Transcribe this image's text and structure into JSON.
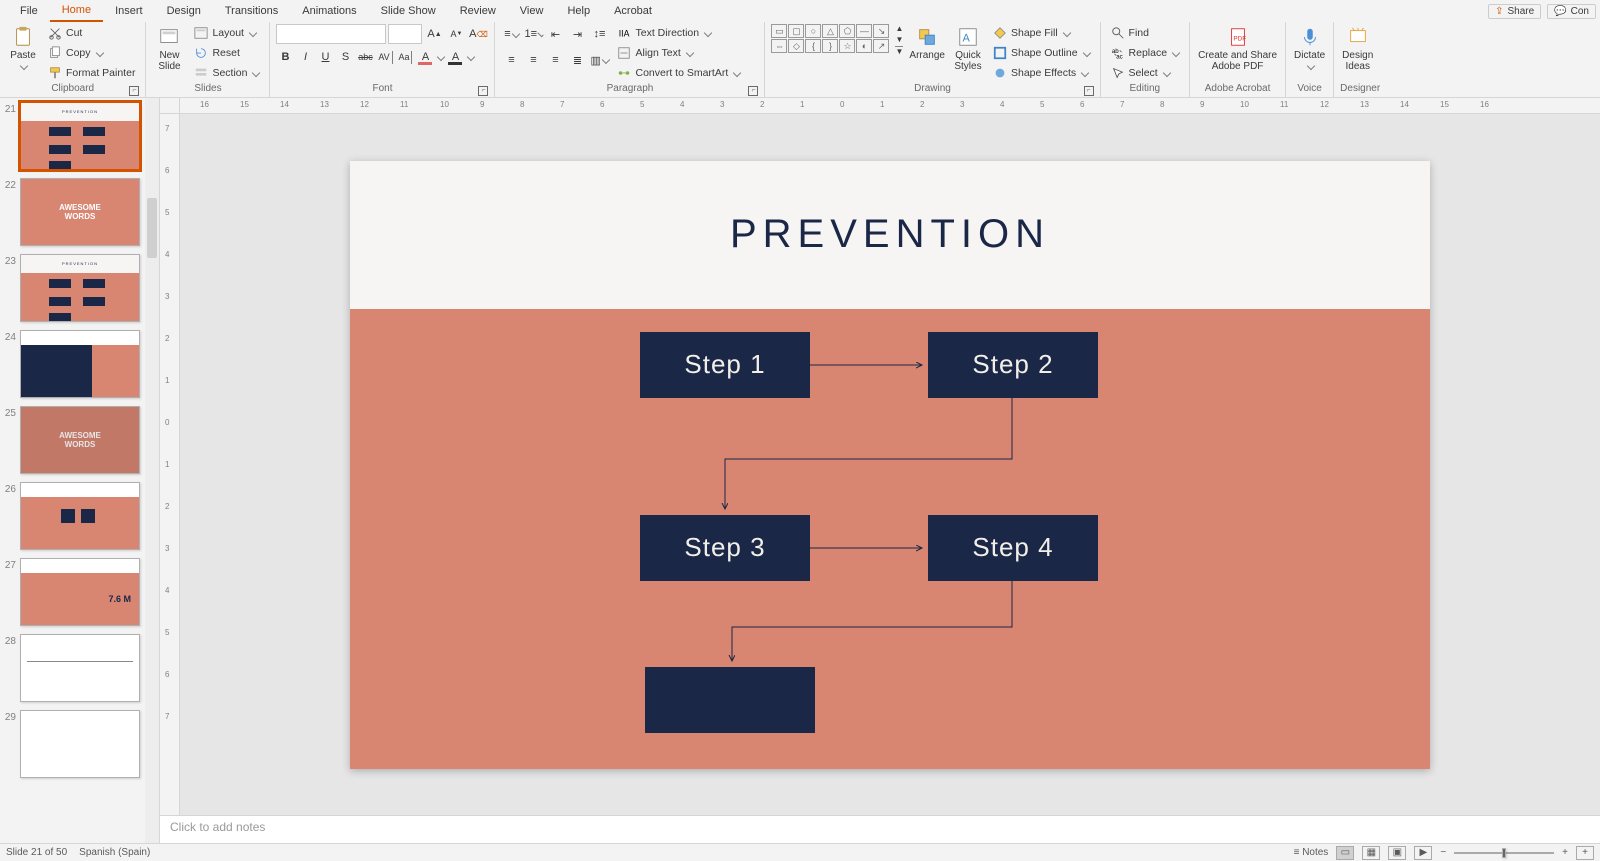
{
  "tabs": {
    "items": [
      "File",
      "Home",
      "Insert",
      "Design",
      "Transitions",
      "Animations",
      "Slide Show",
      "Review",
      "View",
      "Help",
      "Acrobat"
    ],
    "active": 1
  },
  "topright": {
    "share": "Share",
    "comments": "Con"
  },
  "ribbon": {
    "clipboard": {
      "label": "Clipboard",
      "paste": "Paste",
      "cut": "Cut",
      "copy": "Copy",
      "fp": "Format Painter"
    },
    "slides": {
      "label": "Slides",
      "new": "New\nSlide",
      "layout": "Layout",
      "reset": "Reset",
      "section": "Section"
    },
    "font": {
      "label": "Font",
      "family": "",
      "size": "",
      "bold": "B",
      "italic": "I",
      "underline": "U",
      "strike": "S",
      "shadow": "abc",
      "spacing": "AV",
      "case": "Aa",
      "clear": "A"
    },
    "paragraph": {
      "label": "Paragraph",
      "textdir": "Text Direction",
      "align": "Align Text",
      "smart": "Convert to SmartArt"
    },
    "drawing": {
      "label": "Drawing",
      "arrange": "Arrange",
      "quick": "Quick\nStyles",
      "fill": "Shape Fill",
      "outline": "Shape Outline",
      "effects": "Shape Effects"
    },
    "editing": {
      "label": "Editing",
      "find": "Find",
      "replace": "Replace",
      "select": "Select"
    },
    "adobe": {
      "label": "Adobe Acrobat",
      "btn": "Create and Share\nAdobe PDF"
    },
    "voice": {
      "label": "Voice",
      "btn": "Dictate"
    },
    "designer": {
      "label": "Designer",
      "btn": "Design\nIdeas"
    }
  },
  "hruler": [
    16,
    15,
    14,
    13,
    12,
    11,
    10,
    9,
    8,
    7,
    6,
    5,
    4,
    3,
    2,
    1,
    0,
    1,
    2,
    3,
    4,
    5,
    6,
    7,
    8,
    9,
    10,
    11,
    12,
    13,
    14,
    15,
    16
  ],
  "vruler": [
    7,
    6,
    5,
    4,
    3,
    2,
    1,
    0,
    1,
    2,
    3,
    4,
    5,
    6,
    7
  ],
  "thumbs": [
    {
      "n": 21,
      "kind": "prevention",
      "selected": true
    },
    {
      "n": 22,
      "kind": "awesome"
    },
    {
      "n": 23,
      "kind": "prevention"
    },
    {
      "n": 24,
      "kind": "treatment"
    },
    {
      "n": 25,
      "kind": "awesome2"
    },
    {
      "n": 26,
      "kind": "recs"
    },
    {
      "n": 27,
      "kind": "prevalence"
    },
    {
      "n": 28,
      "kind": "conclusions"
    },
    {
      "n": 29,
      "kind": "blank"
    }
  ],
  "thumb_text": {
    "awesome": "AWESOME\nWORDS",
    "prevalence": "7.6 M"
  },
  "slide": {
    "title": "PREVENTION",
    "steps": [
      "Step 1",
      "Step 2",
      "Step 3",
      "Step 4"
    ]
  },
  "notes": {
    "placeholder": "Click to add notes"
  },
  "status": {
    "left": "Slide 21 of 50",
    "lang": "Spanish (Spain)",
    "notes": "Notes",
    "fit": "+"
  }
}
